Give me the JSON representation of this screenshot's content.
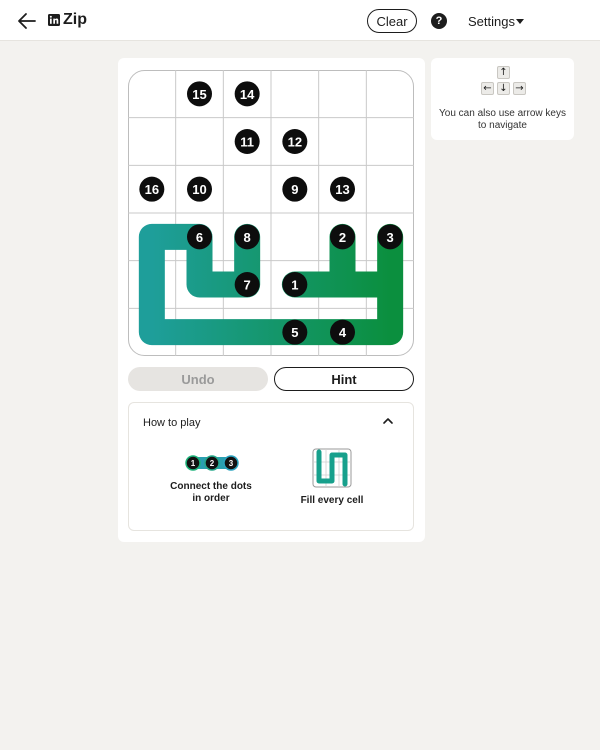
{
  "header": {
    "title": "Zip",
    "clear_label": "Clear",
    "help_symbol": "?",
    "settings_label": "Settings"
  },
  "board": {
    "rows": 6,
    "cols": 6,
    "numbered_cells": [
      {
        "n": 15,
        "row": 0,
        "col": 1
      },
      {
        "n": 14,
        "row": 0,
        "col": 2
      },
      {
        "n": 11,
        "row": 1,
        "col": 2
      },
      {
        "n": 12,
        "row": 1,
        "col": 3
      },
      {
        "n": 16,
        "row": 2,
        "col": 0
      },
      {
        "n": 10,
        "row": 2,
        "col": 1
      },
      {
        "n": 9,
        "row": 2,
        "col": 3
      },
      {
        "n": 13,
        "row": 2,
        "col": 4
      },
      {
        "n": 6,
        "row": 3,
        "col": 1
      },
      {
        "n": 8,
        "row": 3,
        "col": 2
      },
      {
        "n": 2,
        "row": 3,
        "col": 4
      },
      {
        "n": 3,
        "row": 3,
        "col": 5
      },
      {
        "n": 7,
        "row": 4,
        "col": 2
      },
      {
        "n": 1,
        "row": 4,
        "col": 3
      },
      {
        "n": 5,
        "row": 5,
        "col": 3
      },
      {
        "n": 4,
        "row": 5,
        "col": 4
      }
    ],
    "drawn_path": [
      [
        4,
        3
      ],
      [
        4,
        4
      ],
      [
        3,
        4
      ],
      [
        4,
        4
      ],
      [
        4,
        5
      ],
      [
        3,
        5
      ],
      [
        4,
        5
      ],
      [
        5,
        5
      ],
      [
        5,
        4
      ],
      [
        5,
        3
      ],
      [
        5,
        2
      ],
      [
        5,
        1
      ],
      [
        5,
        0
      ],
      [
        4,
        0
      ],
      [
        3,
        0
      ],
      [
        3,
        1
      ],
      [
        4,
        1
      ],
      [
        4,
        2
      ],
      [
        3,
        2
      ]
    ],
    "path_colors": {
      "start": "#0b8f3e",
      "end": "#1e9e9a"
    }
  },
  "actions": {
    "undo_label": "Undo",
    "hint_label": "Hint"
  },
  "how_to_play": {
    "title": "How to play",
    "tip_connect_dots": [
      "1",
      "2",
      "3"
    ],
    "tip_connect_text": "Connect the dots in order",
    "tip_fill_text": "Fill every cell"
  },
  "side_hint": {
    "keys": {
      "up": "↑",
      "left": "←",
      "down": "↓",
      "right": "→"
    },
    "text": "You can also use arrow keys to navigate"
  }
}
